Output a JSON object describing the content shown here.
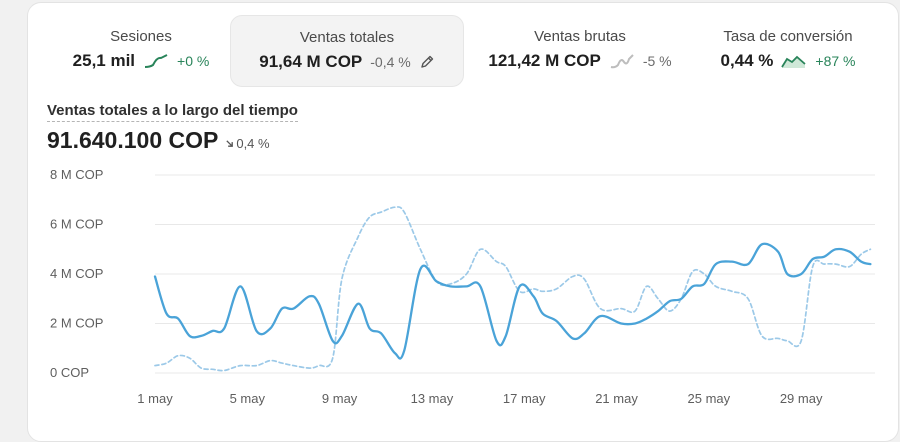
{
  "metrics": [
    {
      "label": "Sesiones",
      "value": "25,1 mil",
      "delta": "+0 %",
      "trend": "up",
      "active": false
    },
    {
      "label": "Ventas totales",
      "value": "91,64 M COP",
      "delta": "-0,4 %",
      "trend": "neutral",
      "active": true
    },
    {
      "label": "Ventas brutas",
      "value": "121,42 M COP",
      "delta": "-5 %",
      "trend": "neutral",
      "active": false
    },
    {
      "label": "Tasa de conversión",
      "value": "0,44 %",
      "delta": "+87 %",
      "trend": "up",
      "active": false
    }
  ],
  "chart_header": {
    "title": "Ventas totales a lo largo del tiempo",
    "total": "91.640.100 COP",
    "delta": "0,4 %"
  },
  "colors": {
    "current": "#4aa3d8",
    "previous": "#9cc9e8",
    "up": "#29845a",
    "grid": "#e8e8e8"
  },
  "chart_data": {
    "type": "line",
    "y_unit": "M COP",
    "ylim": [
      0,
      8
    ],
    "y_ticks": [
      {
        "value": 0,
        "label": "0 COP"
      },
      {
        "value": 2,
        "label": "2 M COP"
      },
      {
        "value": 4,
        "label": "4 M COP"
      },
      {
        "value": 6,
        "label": "6 M COP"
      },
      {
        "value": 8,
        "label": "8 M COP"
      }
    ],
    "x_day_range": [
      1,
      31
    ],
    "x_ticks": [
      {
        "day": 1,
        "label": "1 may"
      },
      {
        "day": 5,
        "label": "5 may"
      },
      {
        "day": 9,
        "label": "9 may"
      },
      {
        "day": 13,
        "label": "13 may"
      },
      {
        "day": 17,
        "label": "17 may"
      },
      {
        "day": 21,
        "label": "21 may"
      },
      {
        "day": 25,
        "label": "25 may"
      },
      {
        "day": 29,
        "label": "29 may"
      }
    ],
    "grid": true,
    "series": [
      {
        "style": "solid",
        "color": "#4aa3d8",
        "points": [
          [
            1,
            3.9
          ],
          [
            1.5,
            2.4
          ],
          [
            2,
            2.2
          ],
          [
            2.5,
            1.5
          ],
          [
            3,
            1.5
          ],
          [
            3.5,
            1.7
          ],
          [
            4,
            1.8
          ],
          [
            4.7,
            3.5
          ],
          [
            5.4,
            1.7
          ],
          [
            6,
            1.8
          ],
          [
            6.5,
            2.6
          ],
          [
            7,
            2.6
          ],
          [
            7.7,
            3.1
          ],
          [
            8.1,
            2.8
          ],
          [
            8.7,
            1.3
          ],
          [
            9.1,
            1.5
          ],
          [
            9.8,
            2.8
          ],
          [
            10.3,
            1.8
          ],
          [
            10.8,
            1.6
          ],
          [
            11.4,
            0.8
          ],
          [
            11.8,
            0.9
          ],
          [
            12.5,
            4.2
          ],
          [
            13.2,
            3.7
          ],
          [
            13.8,
            3.5
          ],
          [
            14.5,
            3.5
          ],
          [
            15.1,
            3.5
          ],
          [
            15.8,
            1.3
          ],
          [
            16.2,
            1.5
          ],
          [
            16.8,
            3.5
          ],
          [
            17.4,
            3.1
          ],
          [
            17.8,
            2.4
          ],
          [
            18.4,
            2.1
          ],
          [
            19.1,
            1.4
          ],
          [
            19.6,
            1.6
          ],
          [
            20.3,
            2.3
          ],
          [
            21.2,
            2.0
          ],
          [
            21.8,
            2.0
          ],
          [
            22.3,
            2.2
          ],
          [
            22.8,
            2.5
          ],
          [
            23.3,
            2.9
          ],
          [
            23.8,
            3.0
          ],
          [
            24.3,
            3.5
          ],
          [
            24.8,
            3.6
          ],
          [
            25.3,
            4.4
          ],
          [
            26,
            4.5
          ],
          [
            26.7,
            4.4
          ],
          [
            27.3,
            5.2
          ],
          [
            28,
            4.9
          ],
          [
            28.4,
            4.0
          ],
          [
            29,
            4.0
          ],
          [
            29.5,
            4.6
          ],
          [
            30,
            4.7
          ],
          [
            30.5,
            5.0
          ],
          [
            31.1,
            4.9
          ],
          [
            31.6,
            4.5
          ],
          [
            32,
            4.4
          ]
        ]
      },
      {
        "style": "dashed",
        "color": "#9cc9e8",
        "points": [
          [
            1,
            0.3
          ],
          [
            1.5,
            0.4
          ],
          [
            2,
            0.7
          ],
          [
            2.5,
            0.6
          ],
          [
            3,
            0.2
          ],
          [
            3.5,
            0.15
          ],
          [
            4,
            0.1
          ],
          [
            4.7,
            0.3
          ],
          [
            5.4,
            0.3
          ],
          [
            6,
            0.5
          ],
          [
            6.5,
            0.4
          ],
          [
            7,
            0.3
          ],
          [
            7.7,
            0.2
          ],
          [
            8.1,
            0.3
          ],
          [
            8.7,
            0.6
          ],
          [
            9.1,
            3.8
          ],
          [
            9.8,
            5.5
          ],
          [
            10.3,
            6.3
          ],
          [
            10.8,
            6.5
          ],
          [
            11.4,
            6.7
          ],
          [
            11.8,
            6.5
          ],
          [
            12.5,
            5.0
          ],
          [
            13.2,
            3.7
          ],
          [
            13.8,
            3.6
          ],
          [
            14.5,
            4.0
          ],
          [
            15.1,
            5.0
          ],
          [
            15.8,
            4.5
          ],
          [
            16.2,
            4.3
          ],
          [
            16.8,
            3.3
          ],
          [
            17.4,
            3.4
          ],
          [
            17.8,
            3.3
          ],
          [
            18.4,
            3.4
          ],
          [
            19.1,
            3.9
          ],
          [
            19.6,
            3.8
          ],
          [
            20.3,
            2.6
          ],
          [
            21.2,
            2.6
          ],
          [
            21.8,
            2.5
          ],
          [
            22.3,
            3.5
          ],
          [
            22.8,
            3.0
          ],
          [
            23.3,
            2.5
          ],
          [
            23.8,
            3.0
          ],
          [
            24.3,
            4.1
          ],
          [
            24.8,
            4.0
          ],
          [
            25.3,
            3.5
          ],
          [
            26,
            3.3
          ],
          [
            26.7,
            3.0
          ],
          [
            27.3,
            1.5
          ],
          [
            28,
            1.4
          ],
          [
            28.4,
            1.3
          ],
          [
            29,
            1.3
          ],
          [
            29.5,
            4.3
          ],
          [
            30,
            4.4
          ],
          [
            30.5,
            4.4
          ],
          [
            31.1,
            4.3
          ],
          [
            31.6,
            4.8
          ],
          [
            32,
            5.0
          ]
        ]
      }
    ]
  }
}
